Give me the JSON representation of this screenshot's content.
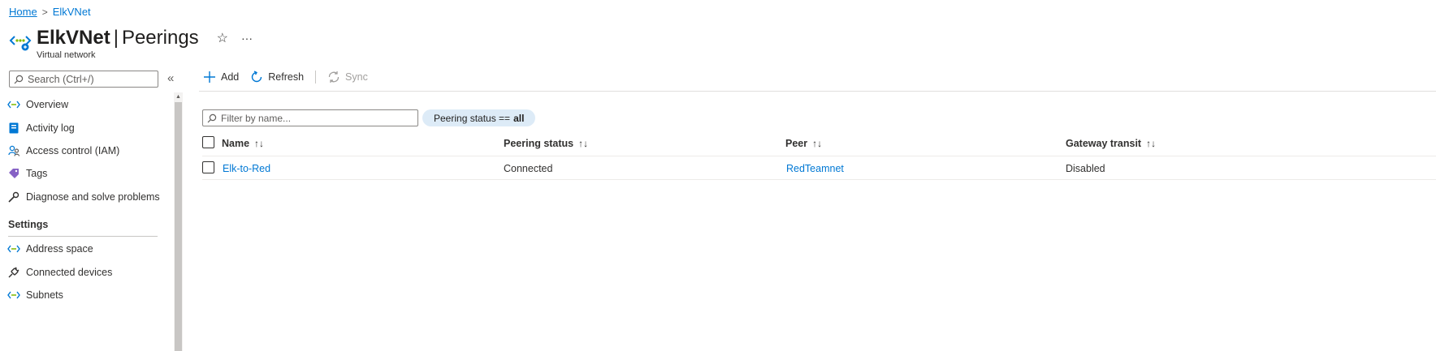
{
  "breadcrumb": {
    "home": "Home",
    "separator": ">",
    "current": "ElkVNet"
  },
  "header": {
    "resource_name": "ElkVNet",
    "separator": "|",
    "page_title": "Peerings",
    "subtitle": "Virtual network",
    "favorite_icon": "star-icon",
    "more_icon": "ellipsis-icon"
  },
  "sidebar": {
    "search_placeholder": "Search (Ctrl+/)",
    "collapse_glyph": "«",
    "items": [
      {
        "label": "Overview",
        "icon": "vnet-icon"
      },
      {
        "label": "Activity log",
        "icon": "activity-log-icon"
      },
      {
        "label": "Access control (IAM)",
        "icon": "people-icon"
      },
      {
        "label": "Tags",
        "icon": "tag-icon"
      },
      {
        "label": "Diagnose and solve problems",
        "icon": "wrench-icon"
      }
    ],
    "section_settings": "Settings",
    "settings_items": [
      {
        "label": "Address space",
        "icon": "vnet-icon"
      },
      {
        "label": "Connected devices",
        "icon": "plug-icon"
      },
      {
        "label": "Subnets",
        "icon": "vnet-icon"
      }
    ]
  },
  "toolbar": {
    "add": "Add",
    "refresh": "Refresh",
    "sync": "Sync"
  },
  "filter": {
    "placeholder": "Filter by name...",
    "pill_prefix": "Peering status ==",
    "pill_value": "all"
  },
  "table": {
    "columns": [
      "Name",
      "Peering status",
      "Peer",
      "Gateway transit"
    ],
    "sort_glyph": "↑↓",
    "rows": [
      {
        "name": "Elk-to-Red",
        "status": "Connected",
        "peer": "RedTeamnet",
        "gateway_transit": "Disabled"
      }
    ]
  },
  "colors": {
    "link": "#0078d4",
    "pill_bg": "#ddebf7",
    "accent": "#0078d4"
  }
}
